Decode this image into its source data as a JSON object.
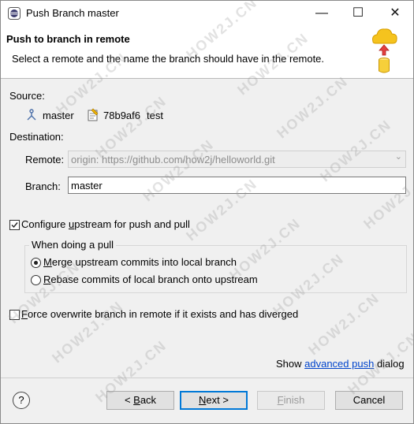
{
  "window": {
    "title": "Push Branch master",
    "controls": [
      "—",
      "☐",
      "✕"
    ]
  },
  "banner": {
    "title": "Push to branch in remote",
    "message": "Select a remote and the name the branch should have in the remote."
  },
  "source": {
    "label": "Source:",
    "branch": "master",
    "commit_id": "78b9af6",
    "commit_message": "test"
  },
  "destination": {
    "label": "Destination:",
    "remote_label": "Remote:",
    "remote_value": "origin: https://github.com/how2j/helloworld.git",
    "branch_label": "Branch:",
    "branch_value": "master"
  },
  "options": {
    "configure_upstream": {
      "label_pre": "Configure ",
      "mnemonic": "u",
      "label_post": "pstream for push and pull",
      "checked": true
    },
    "pull_group_label": "When doing a pull",
    "merge": {
      "mnemonic": "M",
      "label_post": "erge upstream commits into local branch",
      "selected": true
    },
    "rebase": {
      "mnemonic": "R",
      "label_post": "ebase commits of local branch onto upstream",
      "selected": false
    },
    "force": {
      "mnemonic": "F",
      "label_post": "orce overwrite branch in remote if it exists and has diverged",
      "checked": false
    }
  },
  "advanced": {
    "pre": "Show ",
    "link": "advanced push",
    "post": " dialog"
  },
  "buttons": {
    "help": "?",
    "back_pre": "< ",
    "back_mn": "B",
    "back_post": "ack",
    "next_mn": "N",
    "next_post": "ext >",
    "finish_mn": "F",
    "finish_post": "inish",
    "cancel": "Cancel"
  },
  "watermark_text": "HOW2J.CN"
}
